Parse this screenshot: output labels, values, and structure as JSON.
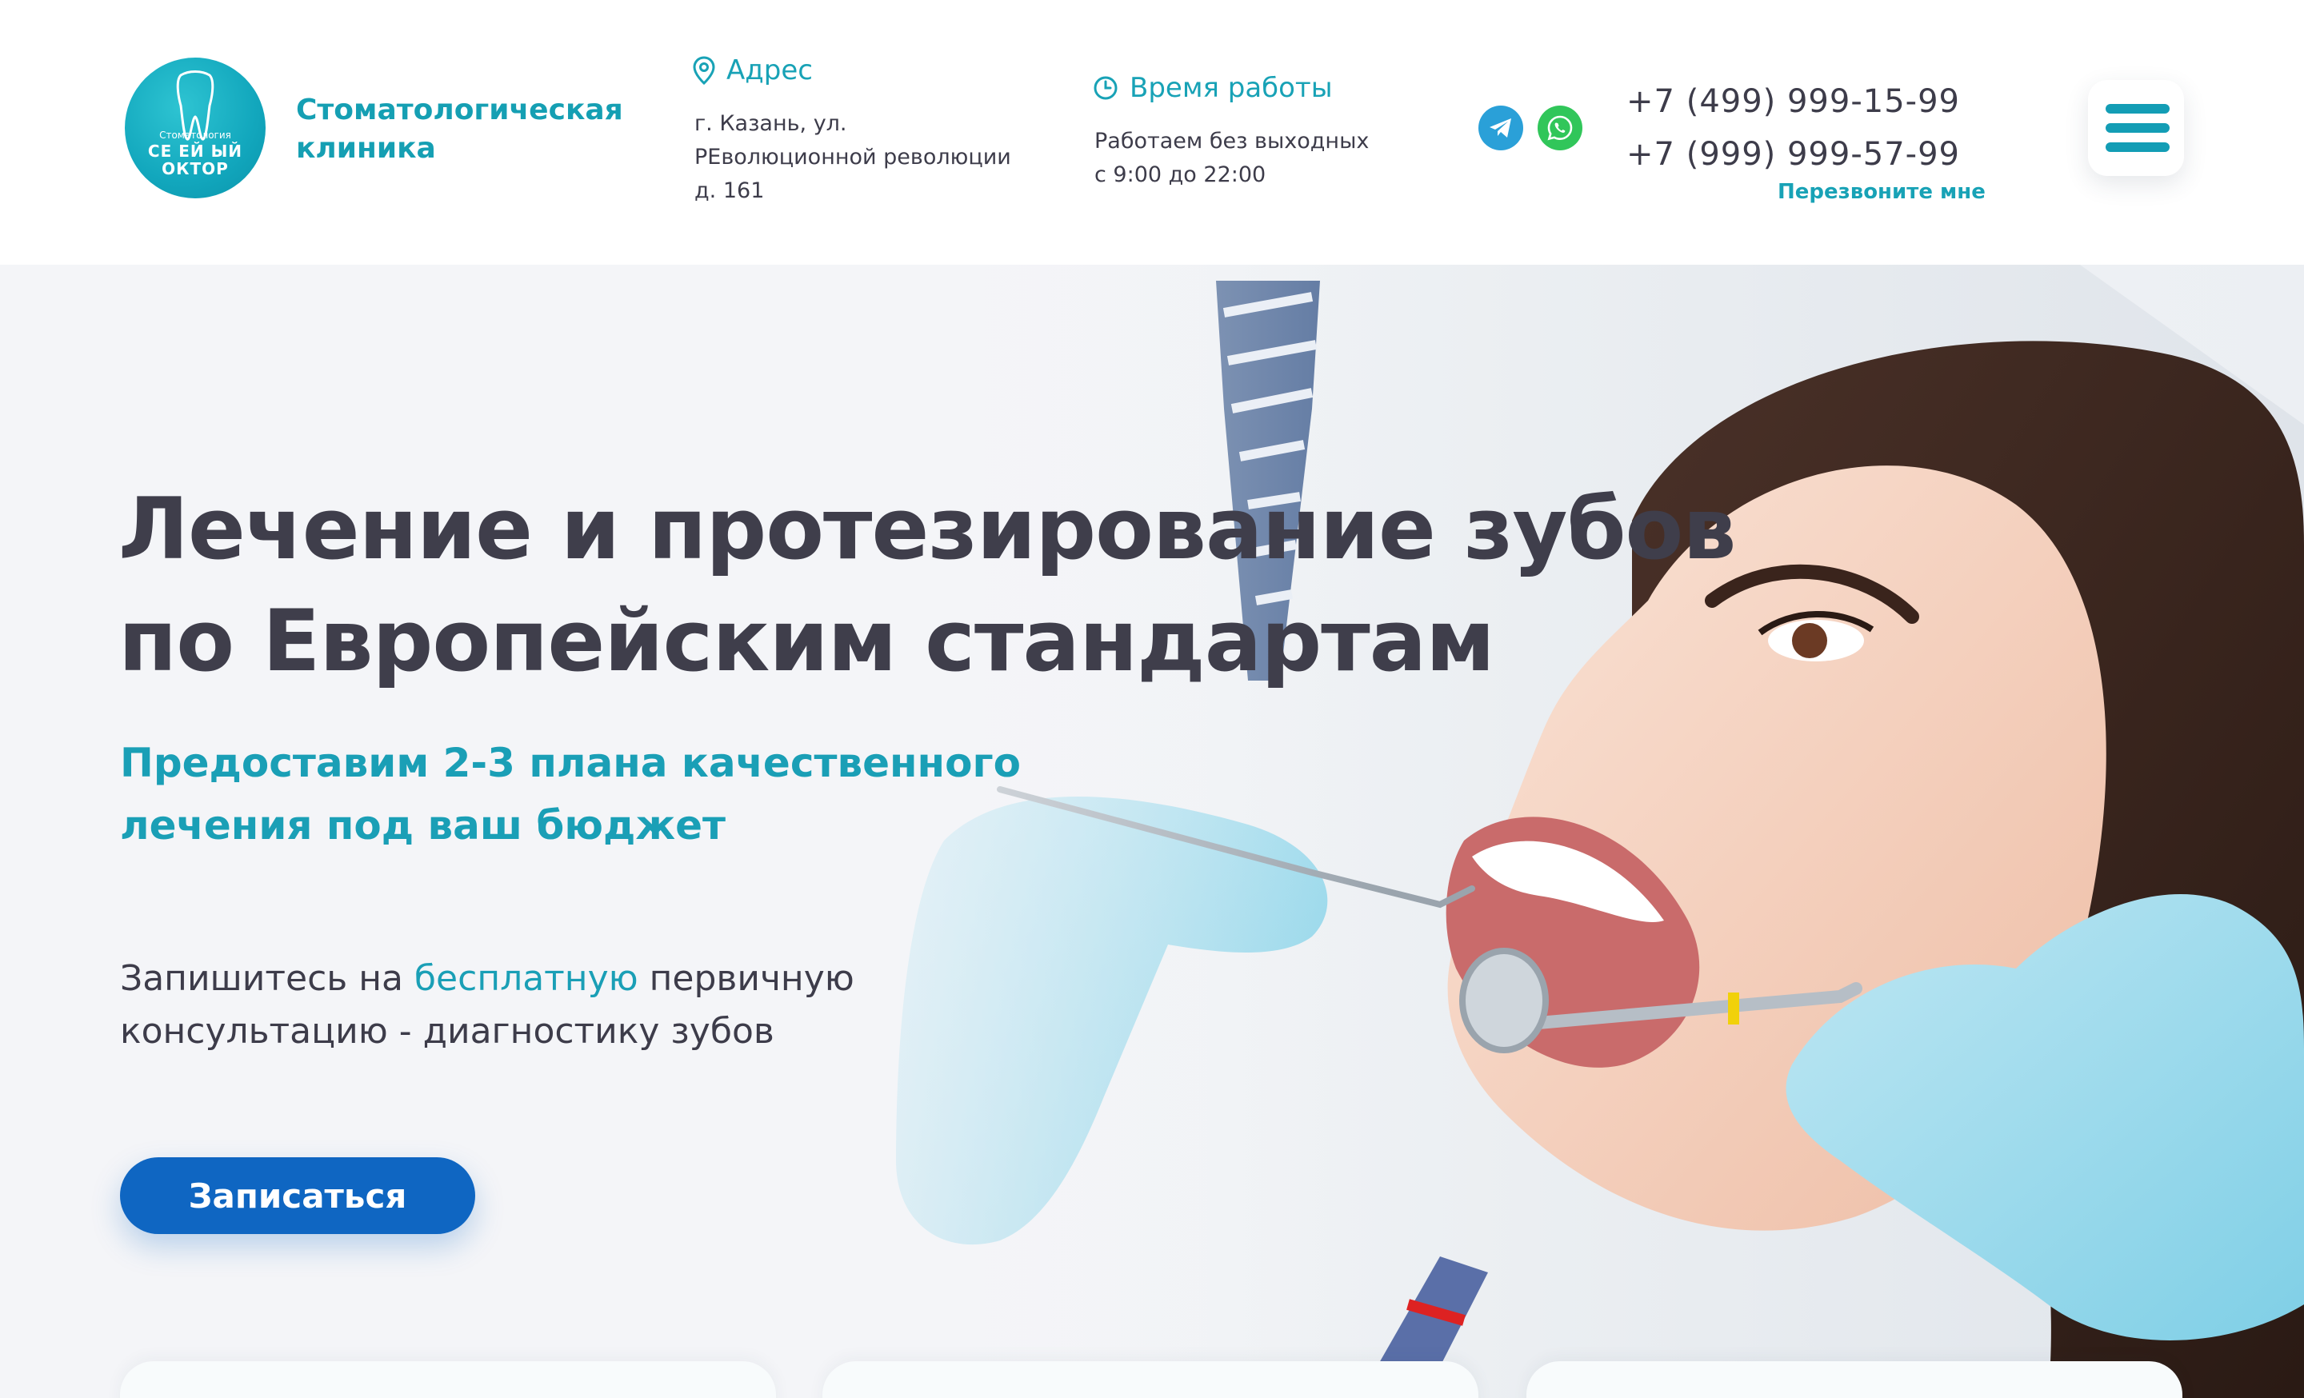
{
  "header": {
    "logo": {
      "small_text": "Стоматология",
      "big_text": "СЕ ЕЙ ЫЙ ОКТОР",
      "icon": "tooth-icon"
    },
    "clinic_name": "Стоматологическая клиника",
    "address": {
      "title": "Адрес",
      "icon": "map-pin-icon",
      "line1": "г. Казань, ул.",
      "line2": "РЕволюционной революции",
      "line3": "д. 161"
    },
    "hours": {
      "title": "Время работы",
      "icon": "clock-icon",
      "line1": "Работаем без выходных",
      "line2": "с 9:00 до 22:00"
    },
    "social": {
      "telegram_icon": "telegram-icon",
      "whatsapp_icon": "whatsapp-icon"
    },
    "phones": [
      "+7 (499) 999-15-99",
      "+7 (999) 999-57-99"
    ],
    "callback_label": "Перезвоните мне",
    "menu_icon": "hamburger-menu-icon"
  },
  "hero": {
    "title_line1": "Лечение и протезирование зубов",
    "title_line2": "по Европейским стандартам",
    "subtitle_line1": "Предоставим 2-3 плана качественного",
    "subtitle_line2": "лечения под ваш бюджет",
    "lead_part1": "Запишитесь на ",
    "lead_highlight": "бесплатную",
    "lead_part2": " первичную",
    "lead_line2": "консультацию - диагностику зубов",
    "cta_label": "Записаться"
  },
  "colors": {
    "accent": "#1a9fb6",
    "button": "#0f66c2",
    "text": "#3d3c4a",
    "telegram": "#2aa0d8",
    "whatsapp": "#31c65a"
  }
}
